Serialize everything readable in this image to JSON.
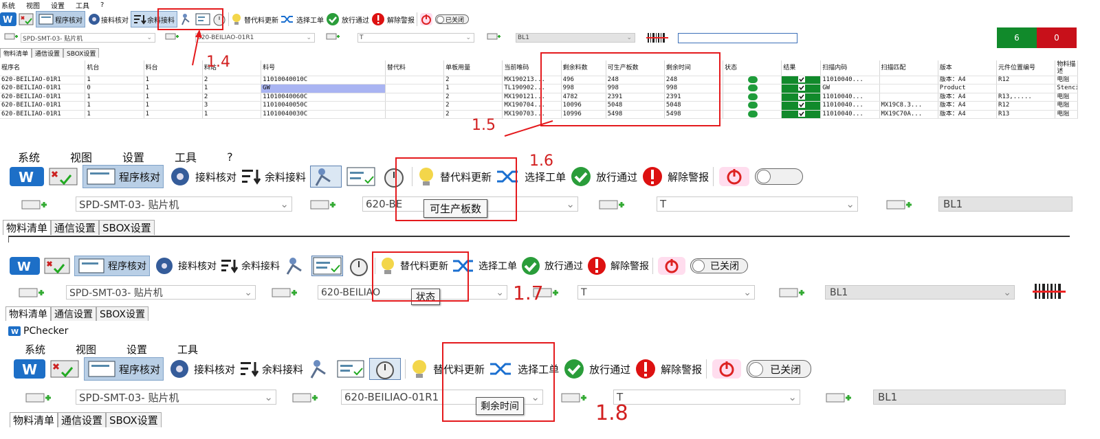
{
  "menu": [
    "系统",
    "视图",
    "设置",
    "工具",
    "?"
  ],
  "toolbar": {
    "program_check": "程序核对",
    "splice_check": "接料核对",
    "splice_check_short": "接料核对",
    "remaining_splice": "余料接料",
    "alt_update": "替代料更新",
    "select_wo": "选择工单",
    "release_pass": "放行通过",
    "clear_alarm": "解除警报",
    "toggle_off": "已关闭"
  },
  "combos": {
    "machine": "SPD-SMT-03- 贴片机",
    "program": "620-BEILIAO-01R1",
    "program_cut_6": "620-BE",
    "program_cut_7": "620-BEILIAO",
    "program_cut_8": "620-BEILIAO-01R1",
    "side": "T",
    "line": "BL1"
  },
  "tabs": [
    "物料清单",
    "通信设置",
    "SBOX设置"
  ],
  "counters": {
    "pass": "6",
    "fail": "0"
  },
  "app_title": "PChecker",
  "table": {
    "headers": [
      "程序名",
      "机台",
      "料台",
      "料站",
      "料号",
      "替代料",
      "单板用量",
      "当前唯码",
      "剩余料数",
      "可生产板数",
      "剩余时间",
      "状态",
      "结果",
      "扫描内码",
      "扫描匹配",
      "版本",
      "元件位置编号",
      "物料描述"
    ],
    "rows": [
      [
        "620-BEILIAO-01R1",
        "1",
        "1",
        "2",
        "11010040010C",
        "",
        "2",
        "MX190213...",
        "496",
        "248",
        "248",
        "",
        "",
        "11010040...",
        "",
        "版本：A4",
        "R12",
        "电阻"
      ],
      [
        "620-BEILIAO-01R1",
        "0",
        "1",
        "1",
        "GW",
        "",
        "1",
        "TL190902...",
        "998",
        "998",
        "998",
        "",
        "",
        "GW",
        "",
        "Product",
        "",
        "Stencil"
      ],
      [
        "620-BEILIAO-01R1",
        "1",
        "1",
        "2",
        "11010040060C",
        "",
        "2",
        "MX190121...",
        "4782",
        "2391",
        "2391",
        "",
        "",
        "11010040...",
        "",
        "版本：A4",
        "R13,.....",
        "电阻"
      ],
      [
        "620-BEILIAO-01R1",
        "1",
        "1",
        "3",
        "11010040050C",
        "",
        "2",
        "MX190704...",
        "10096",
        "5048",
        "5048",
        "",
        "",
        "11010040...",
        "MX19C8.3...",
        "版本：A4",
        "R12",
        "电阻"
      ],
      [
        "620-BEILIAO-01R1",
        "1",
        "1",
        "1",
        "11010040030C",
        "",
        "2",
        "MX190703...",
        "10996",
        "5498",
        "5498",
        "",
        "",
        "11010040...",
        "MX19C70A...",
        "版本：A4",
        "R13",
        "电阻"
      ]
    ]
  },
  "annotations": {
    "a14": "1.4",
    "a15": "1.5",
    "a16": "1.6",
    "a17": "1.7",
    "a18": "1.8"
  },
  "tooltips": {
    "t16": "可生产板数",
    "t17": "状态",
    "t18": "剩余时间"
  },
  "colors": {
    "active": "#b9cfe6",
    "red_annot": "#e4191c",
    "pass_green": "#118a2b",
    "fail_red": "#c8101a"
  }
}
